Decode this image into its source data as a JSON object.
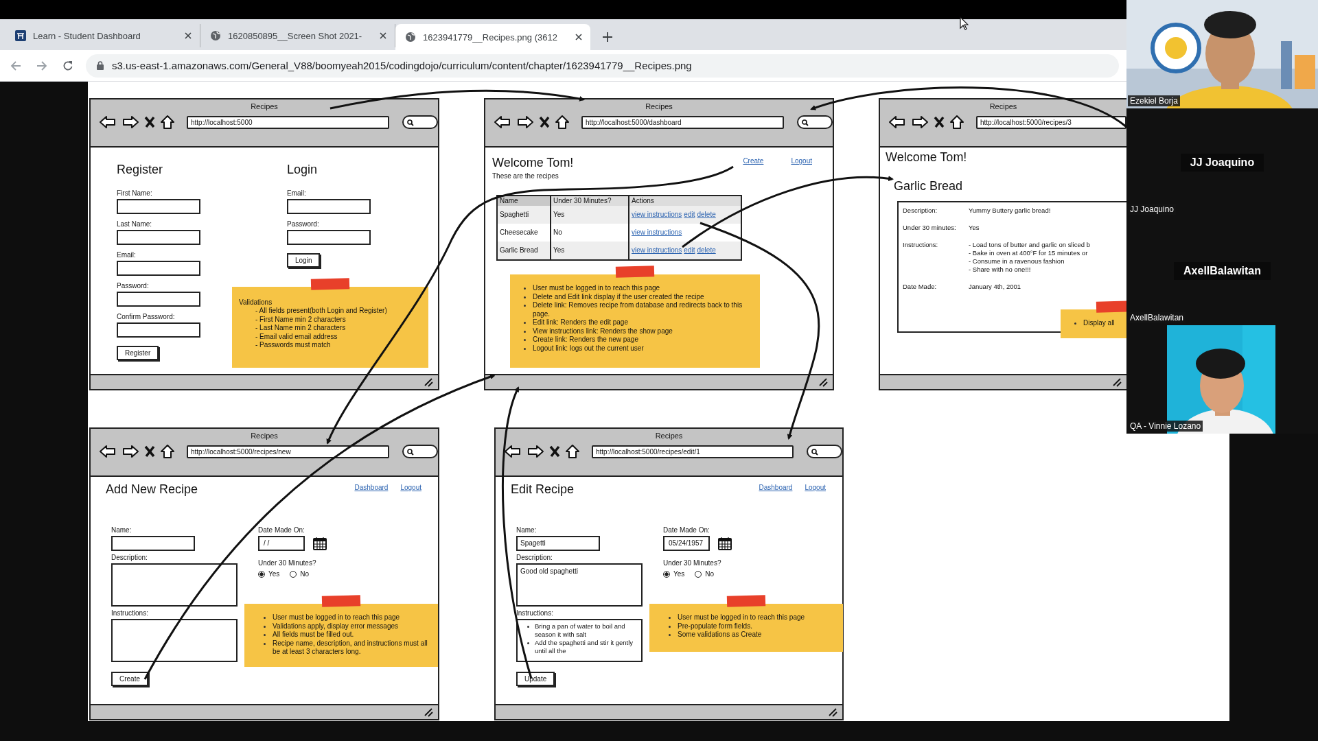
{
  "browser": {
    "tabs": [
      {
        "title": "Learn - Student Dashboard",
        "selected": false
      },
      {
        "title": "1620850895__Screen Shot 2021-",
        "selected": false
      },
      {
        "title": "1623941779__Recipes.png (3612",
        "selected": true
      }
    ],
    "address": "s3.us-east-1.amazonaws.com/General_V88/boomyeah2015/codingdojo/curriculum/content/chapter/1623941779__Recipes.png"
  },
  "wireframes": [
    {
      "kind": "auth",
      "window_title": "Recipes",
      "url": "http://localhost:5000",
      "register": {
        "heading": "Register",
        "fields": [
          "First Name:",
          "Last Name:",
          "Email:",
          "Password:",
          "Confirm Password:"
        ],
        "button": "Register"
      },
      "login": {
        "heading": "Login",
        "fields": [
          "Email:",
          "Password:"
        ],
        "button": "Login"
      },
      "note": {
        "title": "Validations",
        "items": [
          "- All fields present(both Login and Register)",
          "- First Name min 2 characters",
          "- Last Name min 2 characters",
          "- Email valid email address",
          "- Passwords must match"
        ]
      }
    },
    {
      "kind": "dashboard",
      "window_title": "Recipes",
      "url": "http://localhost:5000/dashboard",
      "heading": "Welcome Tom!",
      "links": [
        "Create",
        "Logout"
      ],
      "subtitle": "These are the recipes",
      "table": {
        "columns": [
          "Name",
          "Under 30 Minutes?",
          "Actions"
        ],
        "rows": [
          {
            "cells": [
              "Spaghetti",
              "Yes"
            ],
            "actions": [
              "view instructions",
              "edit",
              "delete"
            ]
          },
          {
            "cells": [
              "Cheesecake",
              "No"
            ],
            "actions": [
              "view instructions"
            ]
          },
          {
            "cells": [
              "Garlic Bread",
              "Yes"
            ],
            "actions": [
              "view instructions",
              "edit",
              "delete"
            ]
          }
        ]
      },
      "note": {
        "bullets": true,
        "items": [
          "User must be logged in to reach this page",
          "Delete and Edit link display if the user created the recipe",
          "Delete link: Removes recipe from database and redirects back to this page.",
          "Edit link: Renders the edit page",
          "View instructions link: Renders the show page",
          "Create link: Renders the new page",
          "Logout link: logs out the current user"
        ]
      }
    },
    {
      "kind": "show",
      "window_title": "Recipes",
      "url": "http://localhost:5000/recipes/3",
      "heading": "Welcome Tom!",
      "recipe": "Garlic Bread",
      "details": [
        {
          "label": "Description:",
          "lines": [
            "Yummy Buttery garlic bread!"
          ]
        },
        {
          "label": "Under 30 minutes:",
          "lines": [
            "Yes"
          ]
        },
        {
          "label": "Instructions:",
          "lines": [
            "- Load tons of butter and garlic on sliced b",
            "- Bake in oven at 400°F for 15 minutes or",
            "- Consume in a ravenous fashion",
            "- Share with no one!!!"
          ]
        },
        {
          "label": "Date Made:",
          "lines": [
            "January 4th, 2001"
          ]
        }
      ],
      "note": {
        "bullets": true,
        "items": [
          "Display all"
        ]
      }
    },
    {
      "kind": "form",
      "window_title": "Recipes",
      "url": "http://localhost:5000/recipes/new",
      "heading": "Add New Recipe",
      "links": [
        "Dashboard",
        "Logout"
      ],
      "name_field": {
        "label": "Name:"
      },
      "description_field": {
        "label": "Description:"
      },
      "instructions_field": {
        "label": "Instructions:"
      },
      "date_field": {
        "label": "Date Made On:",
        "value": "/ /"
      },
      "under_30": {
        "label": "Under 30 Minutes?",
        "options": [
          {
            "label": "Yes",
            "selected": true
          },
          {
            "label": "No",
            "selected": false
          }
        ]
      },
      "button": "Create",
      "note": {
        "bullets": true,
        "items": [
          "User must be logged in to reach this page",
          "Validations apply, display error messages",
          "All fields must be filled out.",
          "Recipe name, description, and instructions must all be at least 3 characters long."
        ]
      }
    },
    {
      "kind": "form",
      "window_title": "Recipes",
      "url": "http://localhost:5000/recipes/edit/1",
      "heading": "Edit Recipe",
      "links": [
        "Dashboard",
        "Logout"
      ],
      "name_field": {
        "label": "Name:",
        "value": "Spagetti"
      },
      "description_field": {
        "label": "Description:",
        "value": "Good old spaghetti"
      },
      "instructions_field": {
        "label": "Instructions:",
        "items": [
          "Bring a pan of water to boil and season it with salt",
          "Add the spaghetti and stir it gently until all the"
        ]
      },
      "date_field": {
        "label": "Date Made On:",
        "value": "05/24/1957"
      },
      "under_30": {
        "label": "Under 30 Minutes?",
        "options": [
          {
            "label": "Yes",
            "selected": true
          },
          {
            "label": "No",
            "selected": false
          }
        ]
      },
      "button": "Update",
      "note": {
        "bullets": true,
        "items": [
          "User must be logged in to reach this page",
          "Pre-populate form fields.",
          "Some validations as Create"
        ]
      }
    }
  ],
  "video_call": {
    "participants": [
      {
        "kind": "video",
        "label": "Ezekiel Borja"
      },
      {
        "kind": "name_card",
        "display_name": "JJ Joaquino",
        "label": "JJ Joaquino"
      },
      {
        "kind": "name_card",
        "display_name": "AxellBalawitan",
        "label": "AxellBalawitan"
      },
      {
        "kind": "video",
        "label": "QA - Vinnie Lozano"
      }
    ]
  }
}
